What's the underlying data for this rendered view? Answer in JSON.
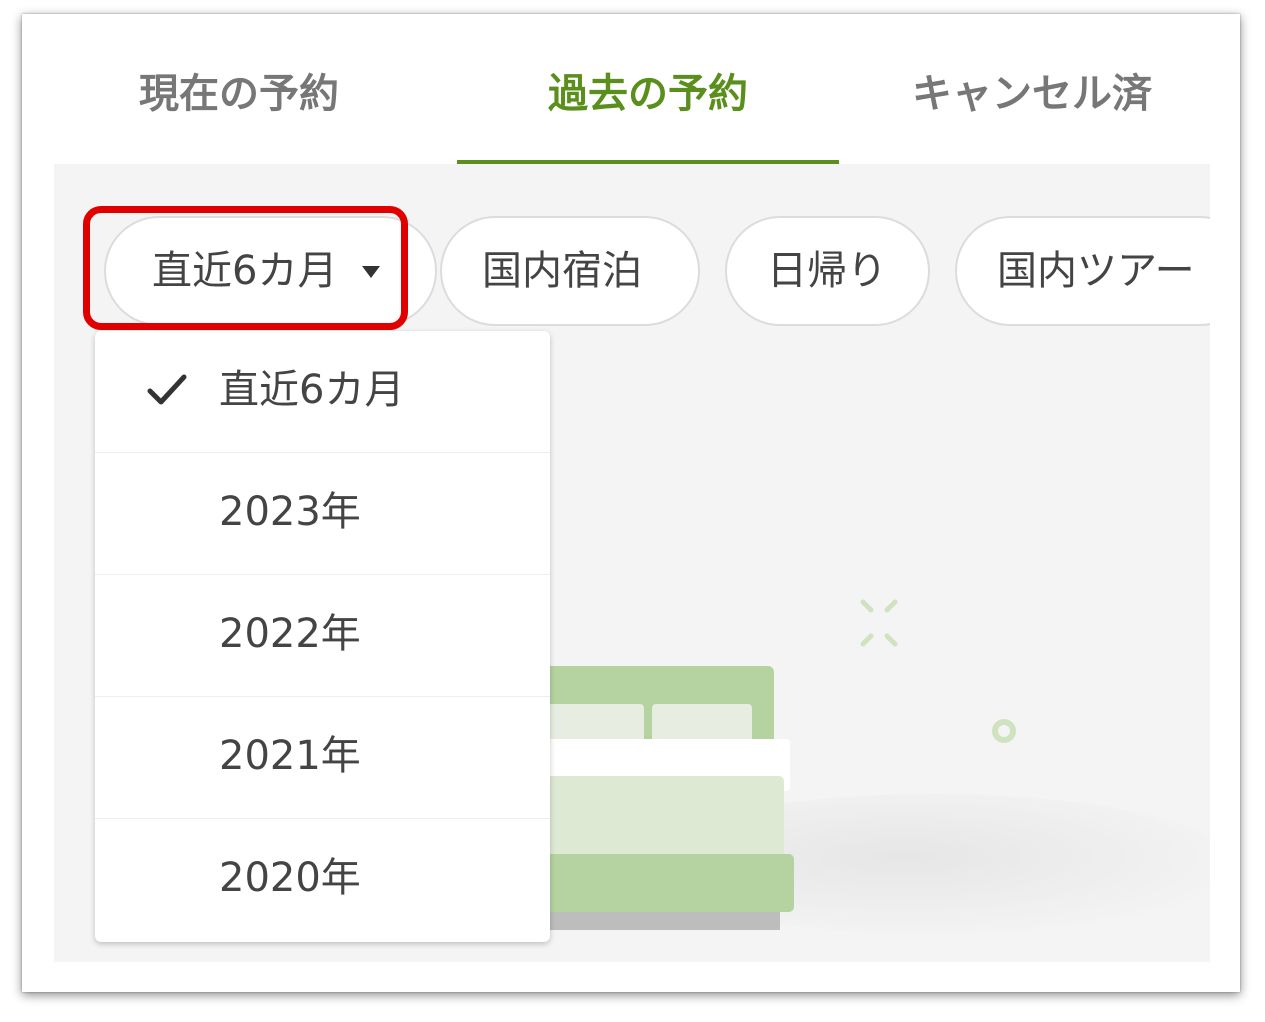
{
  "tabs": [
    {
      "label": "現在の予約",
      "active": false
    },
    {
      "label": "過去の予約",
      "active": true
    },
    {
      "label": "キャンセル済",
      "active": false
    }
  ],
  "filter_chips": {
    "period": {
      "label": "直近6カ月",
      "icon": "caret-down-icon"
    },
    "domestic_stay": {
      "label": "国内宿泊"
    },
    "day_trip": {
      "label": "日帰り"
    },
    "domestic_tour": {
      "label": "国内ツアー"
    }
  },
  "period_dropdown": {
    "options": [
      {
        "label": "直近6カ月",
        "selected": true
      },
      {
        "label": "2023年",
        "selected": false
      },
      {
        "label": "2022年",
        "selected": false
      },
      {
        "label": "2021年",
        "selected": false
      },
      {
        "label": "2020年",
        "selected": false
      }
    ]
  },
  "colors": {
    "accent": "#5a8f1c",
    "highlight": "#e00000",
    "illustration_green": "#b5d3a0"
  }
}
